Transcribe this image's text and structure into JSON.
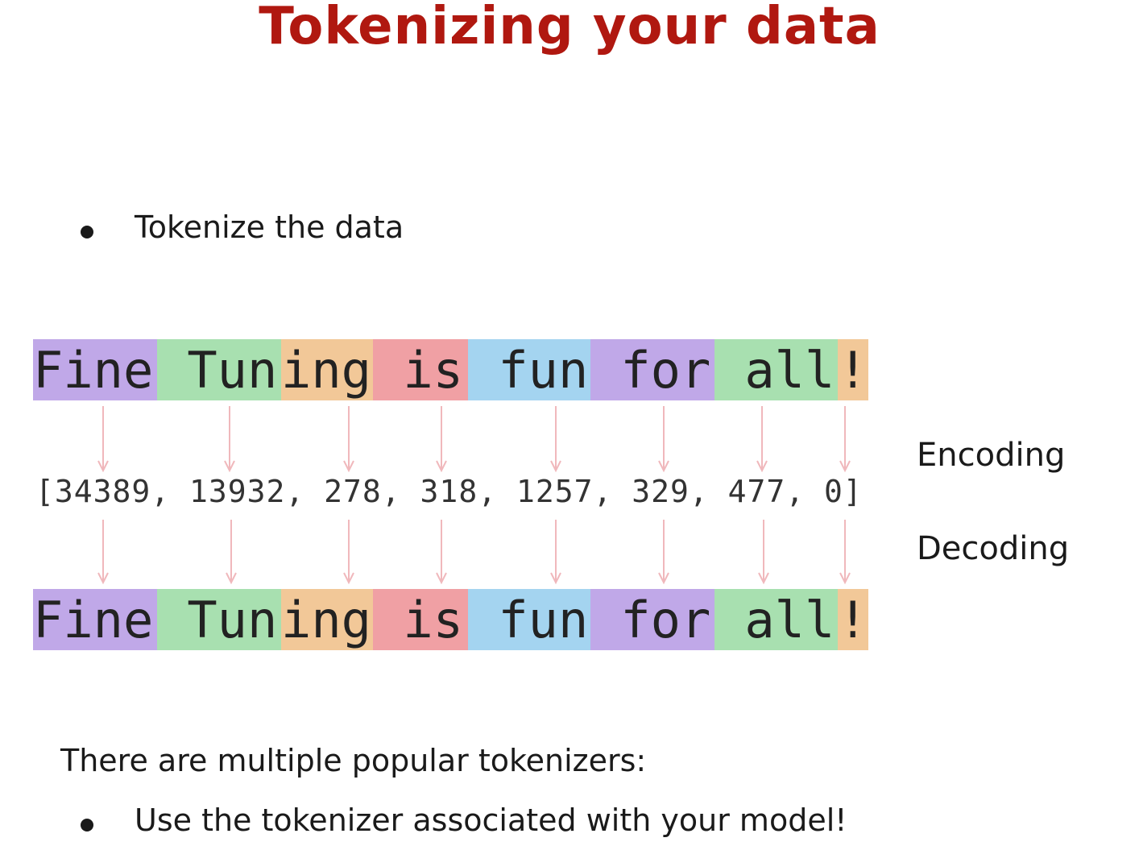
{
  "slide": {
    "title": "Tokenizing your data",
    "bullet_1": "Tokenize the data",
    "intro_text": "There are multiple popular tokenizers:",
    "bullet_2": "Use the tokenizer associated with your model!"
  },
  "tokens": [
    {
      "text": "Fine",
      "color": "#c0a8e8"
    },
    {
      "text": " Tun",
      "color": "#a8e0b0"
    },
    {
      "text": "ing",
      "color": "#f2c898"
    },
    {
      "text": " is",
      "color": "#f0a0a4"
    },
    {
      "text": " fun",
      "color": "#a4d4f0"
    },
    {
      "text": " for",
      "color": "#c0a8e8"
    },
    {
      "text": " all",
      "color": "#a8e0b0"
    },
    {
      "text": "!",
      "color": "#f2c898"
    }
  ],
  "token_ids_text": "[34389, 13932, 278, 318, 1257, 329, 477, 0]",
  "labels": {
    "encoding": "Encoding",
    "decoding": "Decoding"
  },
  "arrow_color": "#f0b8bc"
}
